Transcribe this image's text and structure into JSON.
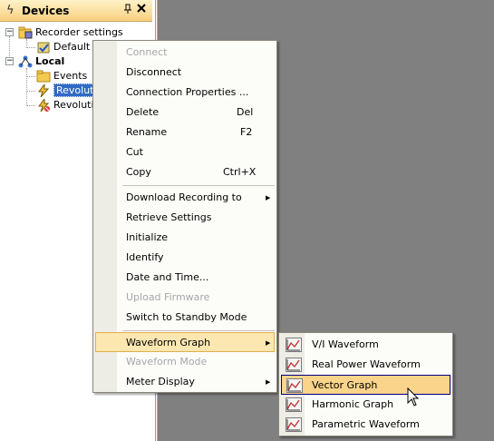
{
  "panel": {
    "title": "Devices",
    "pin_glyph": "📌",
    "close_glyph": "✕"
  },
  "tree": {
    "recorder_settings": "Recorder settings",
    "default_s": "Default s",
    "local": "Local",
    "events": "Events",
    "revolution1": "Revolutio",
    "revolution2": "Revolutio"
  },
  "context_menu": {
    "items": [
      {
        "label": "Connect",
        "shortcut": "",
        "disabled": true
      },
      {
        "label": "Disconnect",
        "shortcut": ""
      },
      {
        "label": "Connection Properties ...",
        "shortcut": ""
      },
      {
        "label": "Delete",
        "shortcut": "Del"
      },
      {
        "label": "Rename",
        "shortcut": "F2"
      },
      {
        "label": "Cut",
        "shortcut": ""
      },
      {
        "label": "Copy",
        "shortcut": "Ctrl+X"
      },
      {
        "label": "Download Recording to",
        "submenu": true
      },
      {
        "label": "Retrieve Settings"
      },
      {
        "label": "Initialize"
      },
      {
        "label": "Identify"
      },
      {
        "label": "Date and Time..."
      },
      {
        "label": "Upload Firmware",
        "disabled": true
      },
      {
        "label": "Switch to Standby Mode"
      },
      {
        "label": "Waveform Graph",
        "submenu": true,
        "highlighted": true
      },
      {
        "label": "Waveform Mode",
        "disabled": true
      },
      {
        "label": "Meter Display",
        "submenu": true
      }
    ]
  },
  "submenu": {
    "items": [
      {
        "label": "V/I Waveform"
      },
      {
        "label": "Real Power Waveform"
      },
      {
        "label": "Vector Graph",
        "highlighted": true
      },
      {
        "label": "Harmonic Graph"
      },
      {
        "label": "Parametric Waveform"
      }
    ]
  },
  "colors": {
    "menu_highlight": "#fde7b0",
    "selection_blue": "#316ac5",
    "workarea": "#808080"
  }
}
